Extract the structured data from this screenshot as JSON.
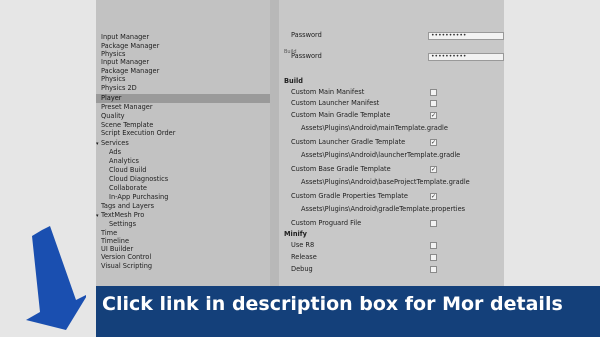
{
  "sidebar": {
    "items": [
      {
        "label": "Input Manager",
        "level": 0
      },
      {
        "label": "Package Manager",
        "level": 0
      },
      {
        "label": "Physics",
        "level": 0
      },
      {
        "label": "Input Manager",
        "level": 0
      },
      {
        "label": "Package Manager",
        "level": 0
      },
      {
        "label": "Physics",
        "level": 0
      },
      {
        "label": "Physics 2D",
        "level": 0
      },
      {
        "label": "Player",
        "level": 0,
        "selected": true
      },
      {
        "label": "Preset Manager",
        "level": 0
      },
      {
        "label": "Quality",
        "level": 0
      },
      {
        "label": "Scene Template",
        "level": 0
      },
      {
        "label": "Script Execution Order",
        "level": 0
      },
      {
        "label": "Services",
        "level": 0,
        "expander": "▾"
      },
      {
        "label": "Ads",
        "level": 1
      },
      {
        "label": "Analytics",
        "level": 1
      },
      {
        "label": "Cloud Build",
        "level": 1
      },
      {
        "label": "Cloud Diagnostics",
        "level": 1
      },
      {
        "label": "Collaborate",
        "level": 1
      },
      {
        "label": "In-App Purchasing",
        "level": 1
      },
      {
        "label": "Tags and Layers",
        "level": 0
      },
      {
        "label": "TextMesh Pro",
        "level": 0,
        "expander": "▾"
      },
      {
        "label": "Settings",
        "level": 1
      },
      {
        "label": "Time",
        "level": 0
      },
      {
        "label": "Timeline",
        "level": 0
      },
      {
        "label": "UI Builder",
        "level": 0
      },
      {
        "label": "Version Control",
        "level": 0
      },
      {
        "label": "Visual Scripting",
        "level": 0
      }
    ]
  },
  "panel": {
    "password_label_top": "Password",
    "password_value_top": "••••••••••",
    "build_ghost": "Build",
    "password_label": "Password",
    "password_value": "••••••••••",
    "build_header": "Build",
    "custom_main_manifest": "Custom Main Manifest",
    "custom_launcher_manifest": "Custom Launcher Manifest",
    "custom_main_gradle": "Custom Main Gradle Template",
    "main_gradle_path": "Assets\\Plugins\\Android\\mainTemplate.gradle",
    "custom_launcher_gradle": "Custom Launcher Gradle Template",
    "launcher_gradle_path": "Assets\\Plugins\\Android\\launcherTemplate.gradle",
    "custom_base_gradle": "Custom Base Gradle Template",
    "base_gradle_path": "Assets\\Plugins\\Android\\baseProjectTemplate.gradle",
    "custom_gradle_props": "Custom Gradle Properties Template",
    "gradle_props_path": "Assets\\Plugins\\Android\\gradleTemplate.properties",
    "custom_proguard": "Custom Proguard File",
    "minify_header": "Minify",
    "use_r8": "Use R8",
    "release": "Release",
    "debug": "Debug",
    "check": "✓"
  },
  "checkboxes": {
    "custom_main_manifest": false,
    "custom_launcher_manifest": false,
    "custom_main_gradle": true,
    "custom_launcher_gradle": true,
    "custom_base_gradle": true,
    "custom_gradle_props": true,
    "custom_proguard": false,
    "use_r8": false,
    "release": false,
    "debug": false
  },
  "banner": {
    "text": "Click link in description box for Mor details"
  },
  "colors": {
    "banner_bg": "#14407a",
    "arrow": "#1a4fb0",
    "selected_row": "#9a9a9a"
  },
  "icons": {
    "arrow": "down-left-arrow",
    "checkbox": "check-mark"
  }
}
